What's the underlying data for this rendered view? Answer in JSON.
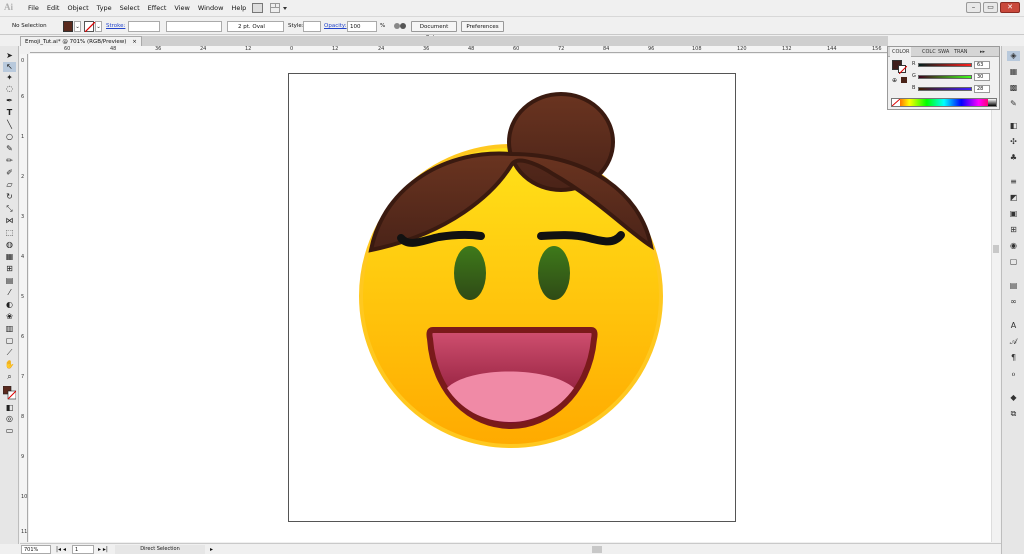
{
  "menubar": {
    "logo": "Ai",
    "items": [
      "File",
      "Edit",
      "Object",
      "Type",
      "Select",
      "Effect",
      "View",
      "Window",
      "Help"
    ],
    "window_buttons": [
      "–",
      "▭",
      "✕"
    ]
  },
  "control": {
    "selection": "No Selection",
    "stroke_label": "Stroke:",
    "brush": "2 pt. Oval",
    "style_label": "Style:",
    "opacity_label": "Opacity:",
    "opacity_value": "100",
    "percent": "%",
    "document_setup": "Document Setup",
    "preferences": "Preferences"
  },
  "document": {
    "tab_title": "Emoji_Tut.ai* @ 701% (RGB/Preview)",
    "tab_close": "×"
  },
  "ruler": {
    "h_ticks": [
      "60",
      "48",
      "36",
      "24",
      "12",
      "0",
      "12",
      "24",
      "36",
      "48",
      "60",
      "72",
      "84",
      "96",
      "108",
      "120",
      "132",
      "144",
      "156"
    ],
    "v_ticks": [
      "0",
      "6",
      "1",
      "2",
      "3",
      "4",
      "5",
      "6",
      "7",
      "8",
      "9",
      "10",
      "11"
    ]
  },
  "color_panel": {
    "tabs": [
      "COLOR",
      "COLC",
      "SWA",
      "TRAN"
    ],
    "r_label": "R",
    "r_value": "63",
    "g_label": "G",
    "g_value": "30",
    "b_label": "B",
    "b_value": "28",
    "fill_color": "#3f1e1c"
  },
  "status": {
    "zoom": "701%",
    "artboard": "1",
    "tool": "Direct Selection"
  },
  "colors": {
    "hair": "#4a2318",
    "face_top": "#ffe21a",
    "face_bottom": "#ffb400",
    "mouth": "#8b1d2b",
    "eye": "#3b6a1e"
  }
}
